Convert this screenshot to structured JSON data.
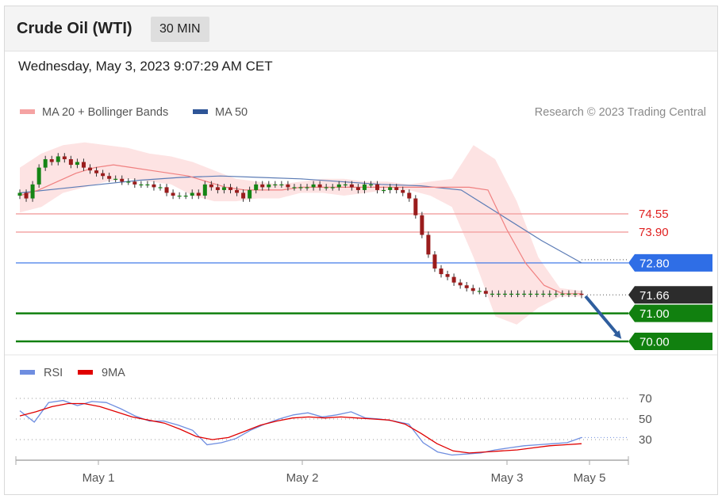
{
  "header": {
    "title": "Crude Oil (WTI)",
    "interval": "30 MIN"
  },
  "timestamp": "Wednesday, May 3, 2023 9:07:29 AM CET",
  "legend": {
    "ma20_bb": "MA 20 + Bollinger Bands",
    "ma50": "MA 50",
    "credit": "Research © 2023 Trading Central",
    "rsi": "RSI",
    "ma9": "9MA"
  },
  "colors": {
    "ma20": "#f08080",
    "ma20_legend": "#f5a3a3",
    "bands": "#fde0e0",
    "ma50": "#5b7bb5",
    "ma50_legend": "#2e5597",
    "resistance": "#f4a6a6",
    "pivot_blue": "#2f6ee6",
    "support_green": "#11800f",
    "price_tag": "#2c2c2c",
    "rsi": "#6f8ee0",
    "ma9": "#e00000",
    "candle_up": "#158515",
    "candle_down": "#9a1c1c",
    "arrow": "#2f5e9e"
  },
  "chart_data": [
    {
      "type": "candlestick",
      "title": "Crude Oil (WTI)",
      "timeframe": "30 MIN",
      "x_labels": [
        "May 1",
        "May 2",
        "May 3",
        "May 5"
      ],
      "ylim": [
        69.7,
        77.3
      ],
      "close": [
        75.3,
        75.1,
        75.6,
        76.2,
        76.5,
        76.4,
        76.6,
        76.5,
        76.3,
        76.4,
        76.2,
        76.1,
        76.0,
        75.9,
        75.8,
        75.8,
        75.7,
        75.7,
        75.6,
        75.6,
        75.6,
        75.5,
        75.5,
        75.3,
        75.2,
        75.2,
        75.2,
        75.3,
        75.2,
        75.6,
        75.5,
        75.4,
        75.5,
        75.4,
        75.3,
        75.1,
        75.4,
        75.6,
        75.5,
        75.6,
        75.6,
        75.6,
        75.5,
        75.5,
        75.5,
        75.5,
        75.6,
        75.5,
        75.5,
        75.5,
        75.6,
        75.6,
        75.5,
        75.4,
        75.6,
        75.6,
        75.4,
        75.4,
        75.5,
        75.4,
        75.3,
        75.1,
        74.5,
        73.8,
        73.1,
        72.6,
        72.4,
        72.3,
        72.1,
        72.0,
        71.9,
        71.8,
        71.8,
        71.7,
        71.7,
        71.7,
        71.7,
        71.7,
        71.7,
        71.7,
        71.7,
        71.7,
        71.7,
        71.7,
        71.7,
        71.7,
        71.7,
        71.7,
        71.66
      ],
      "ma20": [
        75.2,
        75.4,
        75.7,
        76.0,
        76.2,
        76.3,
        76.2,
        76.1,
        76.0,
        75.9,
        75.7,
        75.5,
        75.4,
        75.4,
        75.4,
        75.5,
        75.5,
        75.5,
        75.5,
        75.5,
        75.5,
        75.5,
        75.5,
        75.5,
        75.5,
        75.4,
        74.0,
        72.8,
        72.0,
        71.7,
        71.7
      ],
      "bollinger_upper": [
        76.2,
        76.7,
        77.0,
        77.1,
        77.0,
        76.9,
        76.7,
        76.6,
        76.4,
        76.1,
        75.8,
        75.7,
        75.6,
        75.7,
        75.8,
        75.8,
        75.7,
        75.7,
        75.6,
        75.7,
        75.8,
        77.0,
        76.5,
        75.0,
        73.0,
        71.9,
        71.8
      ],
      "bollinger_lower": [
        74.6,
        74.8,
        75.3,
        75.5,
        75.7,
        75.8,
        75.7,
        75.6,
        75.2,
        75.0,
        75.0,
        75.1,
        75.1,
        75.3,
        75.3,
        75.2,
        75.3,
        75.4,
        75.4,
        75.2,
        74.8,
        73.0,
        70.9,
        70.6,
        71.2,
        71.6,
        71.6
      ],
      "ma50": [
        75.3,
        75.45,
        75.6,
        75.75,
        75.85,
        75.9,
        75.85,
        75.8,
        75.7,
        75.6,
        75.55,
        75.4,
        74.5,
        73.6,
        72.8
      ],
      "levels": [
        {
          "label": "74.55",
          "value": 74.55,
          "color": "#f08080",
          "kind": "resistance"
        },
        {
          "label": "73.90",
          "value": 73.9,
          "color": "#f08080",
          "kind": "resistance"
        },
        {
          "label": "72.80",
          "value": 72.8,
          "color": "#2f6ee6",
          "kind": "pivot"
        },
        {
          "label": "71.66",
          "value": 71.66,
          "color": "#2c2c2c",
          "kind": "last price"
        },
        {
          "label": "71.00",
          "value": 71.0,
          "color": "#11800f",
          "kind": "support"
        },
        {
          "label": "70.00",
          "value": 70.0,
          "color": "#11800f",
          "kind": "support"
        }
      ],
      "forecast": {
        "direction": "down",
        "from": 71.66,
        "to": 70.0
      }
    },
    {
      "type": "line",
      "series_names": [
        "RSI",
        "9MA"
      ],
      "yticks": [
        70,
        50,
        30
      ],
      "ylim": [
        10,
        80
      ],
      "rsi": [
        58,
        47,
        66,
        68,
        63,
        67,
        66,
        60,
        53,
        48,
        48,
        44,
        39,
        25,
        27,
        31,
        39,
        45,
        50,
        54,
        56,
        52,
        54,
        57,
        51,
        50,
        48,
        45,
        27,
        18,
        15,
        16,
        17,
        20,
        22,
        24,
        25,
        26,
        27,
        32
      ],
      "ma9": [
        53,
        57,
        62,
        65,
        65,
        62,
        57,
        52,
        49,
        46,
        40,
        33,
        30,
        32,
        38,
        44,
        48,
        51,
        52,
        51,
        52,
        51,
        50,
        49,
        45,
        36,
        26,
        19,
        17,
        18,
        19,
        20,
        22,
        24,
        25,
        26
      ]
    }
  ]
}
